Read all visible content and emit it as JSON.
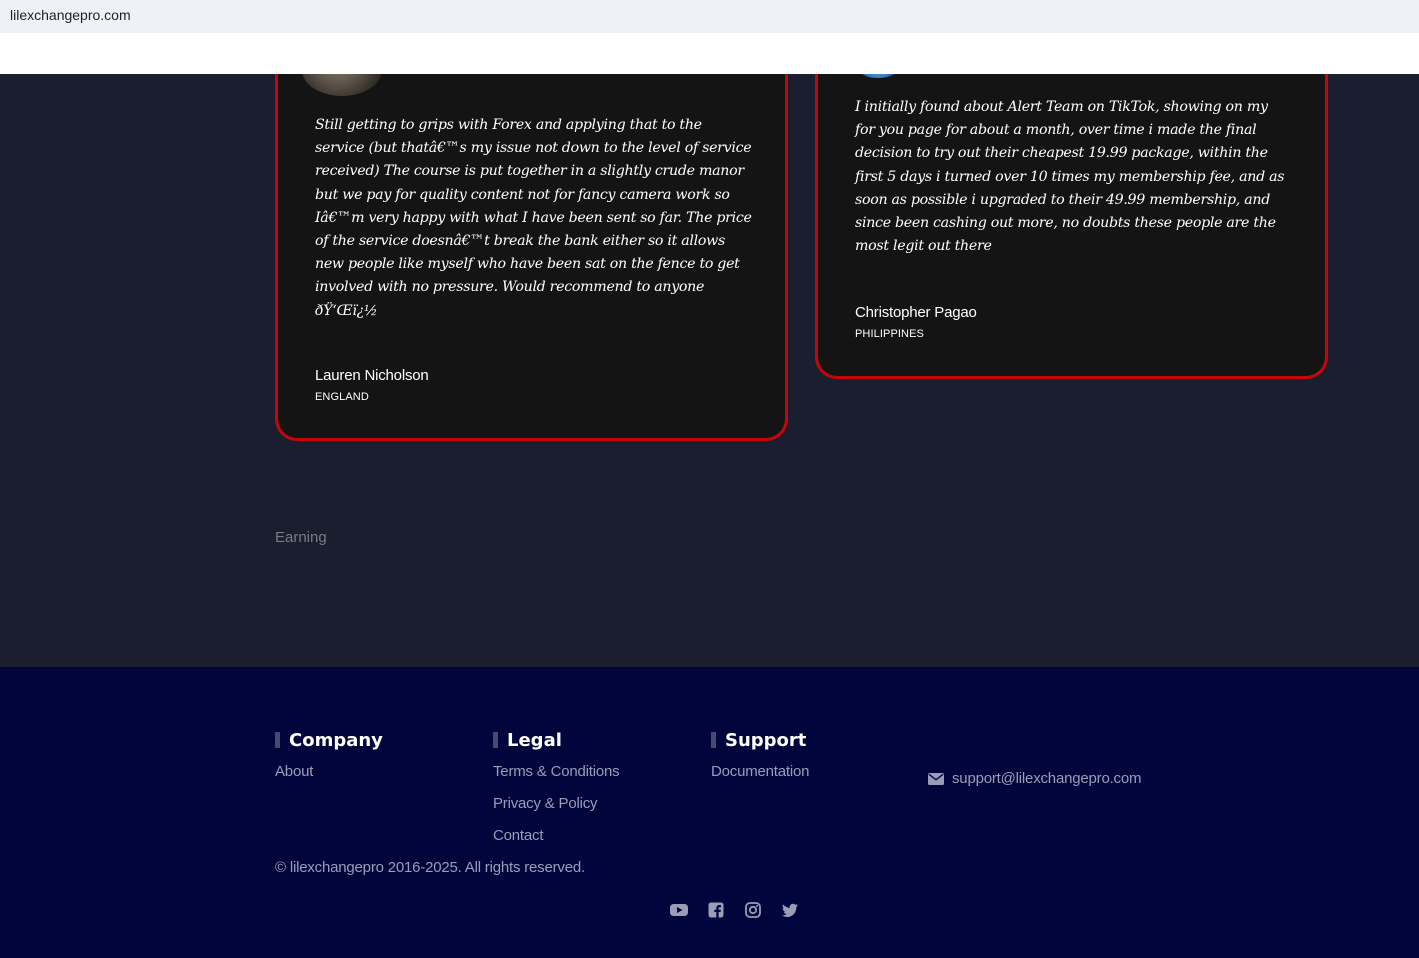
{
  "browser": {
    "url": "lilexchangepro.com"
  },
  "testimonials": [
    {
      "quote": "Still getting to grips with Forex and applying that to the service (but thatâ€™s my issue not down to the level of service received) The course is put together in a slightly crude manor but we pay for quality content not for fancy camera work so Iâ€™m very happy with what I have been sent so far. The price of the service doesnâ€™t break the bank either so it allows new people like myself who have been sat on the fence to get involved with no pressure. Would recommend to anyone ðŸ‘Œï¿½",
      "author": "Lauren Nicholson",
      "country": "ENGLAND"
    },
    {
      "quote": "I initially found about Alert Team on TikTok, showing on my for you page for about a month, over time i made the final decision to try out their cheapest 19.99 package, within the first 5 days i turned over 10 times my membership fee, and as soon as possible i upgraded to their 49.99 membership, and since been cashing out more, no doubts these people are the most legit out there",
      "author": "Christopher Pagao",
      "country": "PHILIPPINES"
    }
  ],
  "earning_label": "Earning",
  "footer": {
    "columns": [
      {
        "title": "Company",
        "links": [
          "About"
        ]
      },
      {
        "title": "Legal",
        "links": [
          "Terms & Conditions",
          "Privacy & Policy",
          "Contact"
        ]
      },
      {
        "title": "Support",
        "links": [
          "Documentation"
        ]
      }
    ],
    "email": "support@lilexchangepro.com",
    "copyright": "© lilexchangepro 2016-2025. All rights reserved.",
    "socials": [
      "youtube-icon",
      "facebook-icon",
      "instagram-icon",
      "twitter-icon"
    ]
  },
  "colors": {
    "page_bg": "#1a1e2e",
    "card_bg": "#141414",
    "card_border": "#c4060c",
    "footer_bg": "#00063c",
    "footer_text": "#9a9cb8"
  }
}
